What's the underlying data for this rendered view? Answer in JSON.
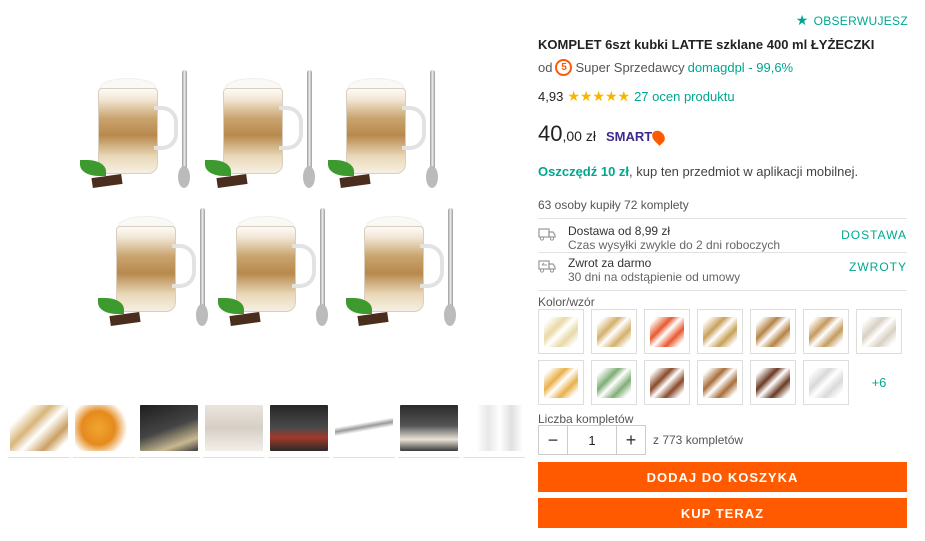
{
  "follow": {
    "label": "OBSERWUJESZ",
    "icon": "star-icon"
  },
  "product": {
    "title": "KOMPLET 6szt kubki LATTE szklane 400 ml ŁYŻECZKI",
    "seller_prefix": "od",
    "seller_badge": "5",
    "seller_type": "Super Sprzedawcy",
    "seller_name": "domagdpl - 99,6%",
    "rating_value": "4,93",
    "rating_stars": "★★★★★",
    "rating_count": "27 ocen produktu",
    "price_main": "40",
    "price_rest": ",00 zł",
    "smart_label": "SMART",
    "save_bold": "Oszczędź 10 zł",
    "save_rest": ", kup ten przedmiot w aplikacji mobilnej.",
    "bought_text": "63 osoby kupiły 72 komplety"
  },
  "shipping": {
    "line1": "Dostawa od 8,99 zł",
    "line2": "Czas wysyłki zwykle do 2 dni roboczych",
    "action": "DOSTAWA"
  },
  "returns": {
    "line1": "Zwrot za darmo",
    "line2": "30 dni na odstąpienie od umowy",
    "action": "ZWROTY"
  },
  "variants": {
    "label": "Kolor/wzór",
    "more": "+6",
    "swatches": [
      "#e8d9a5",
      "#d4b06b",
      "#e65a2e",
      "#c9a15a",
      "#b58345",
      "#c49a5d",
      "#d8d0c2",
      "#e9b14a",
      "#7fae76",
      "#8a4a2b",
      "#a86f3a",
      "#6b3a24",
      "#d9d9d9"
    ]
  },
  "quantity": {
    "label": "Liczba kompletów",
    "value": "1",
    "of_text": "z 773 kompletów"
  },
  "buttons": {
    "add_to_cart": "DODAJ DO KOSZYKA",
    "buy_now": "KUP TERAZ"
  },
  "colors": {
    "accent": "#00a790",
    "cta": "#ff5a00",
    "star": "#f7b500",
    "smart": "#3e2a8e"
  }
}
